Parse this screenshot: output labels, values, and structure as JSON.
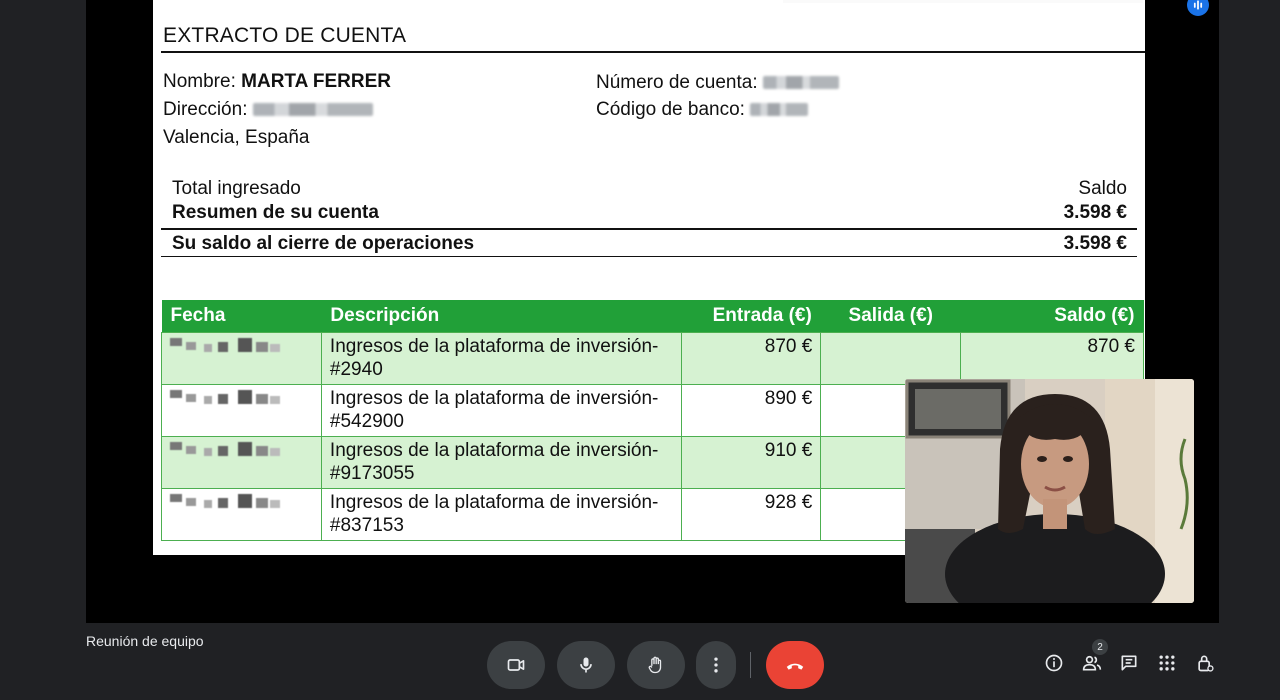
{
  "statement": {
    "title": "EXTRACTO DE CUENTA",
    "name_label": "Nombre:",
    "name_value": "MARTA FERRER",
    "address_label": "Dirección:",
    "address_line2": "Valencia, España",
    "account_label": "Número de cuenta:",
    "bank_code_label": "Código de banco:",
    "total_label": "Total ingresado",
    "balance_header": "Saldo",
    "summary_label": "Resumen de su cuenta",
    "summary_value": "3.598 €",
    "closing_label": "Su saldo al cierre de operaciones",
    "closing_value": "3.598 €"
  },
  "table": {
    "headers": [
      "Fecha",
      "Descripción",
      "Entrada (€)",
      "Salida (€)",
      "Saldo (€)"
    ],
    "rows": [
      {
        "desc1": "Ingresos de la plataforma de inversión-",
        "desc2": "#2940",
        "entrada": "870 €",
        "salida": "",
        "saldo": "870 €"
      },
      {
        "desc1": "Ingresos de la plataforma de inversión-",
        "desc2": "#542900",
        "entrada": "890 €",
        "salida": "",
        "saldo": ""
      },
      {
        "desc1": "Ingresos de la plataforma de inversión-",
        "desc2": "#9173055",
        "entrada": "910 €",
        "salida": "",
        "saldo": ""
      },
      {
        "desc1": "Ingresos de la plataforma de inversión-",
        "desc2": "#837153",
        "entrada": "928 €",
        "salida": "",
        "saldo": ""
      }
    ]
  },
  "meeting": {
    "name": "Reunión de equipo",
    "participant_count": "2"
  },
  "colors": {
    "header_green": "#21a038",
    "row_green": "#d6f2d2",
    "end_call": "#ea4335",
    "bar_bg": "#202124"
  },
  "icons": [
    "camera-icon",
    "microphone-icon",
    "raise-hand-icon",
    "more-options-icon",
    "end-call-icon",
    "info-icon",
    "people-icon",
    "chat-icon",
    "activities-icon",
    "host-controls-icon",
    "speaking-indicator-icon"
  ]
}
